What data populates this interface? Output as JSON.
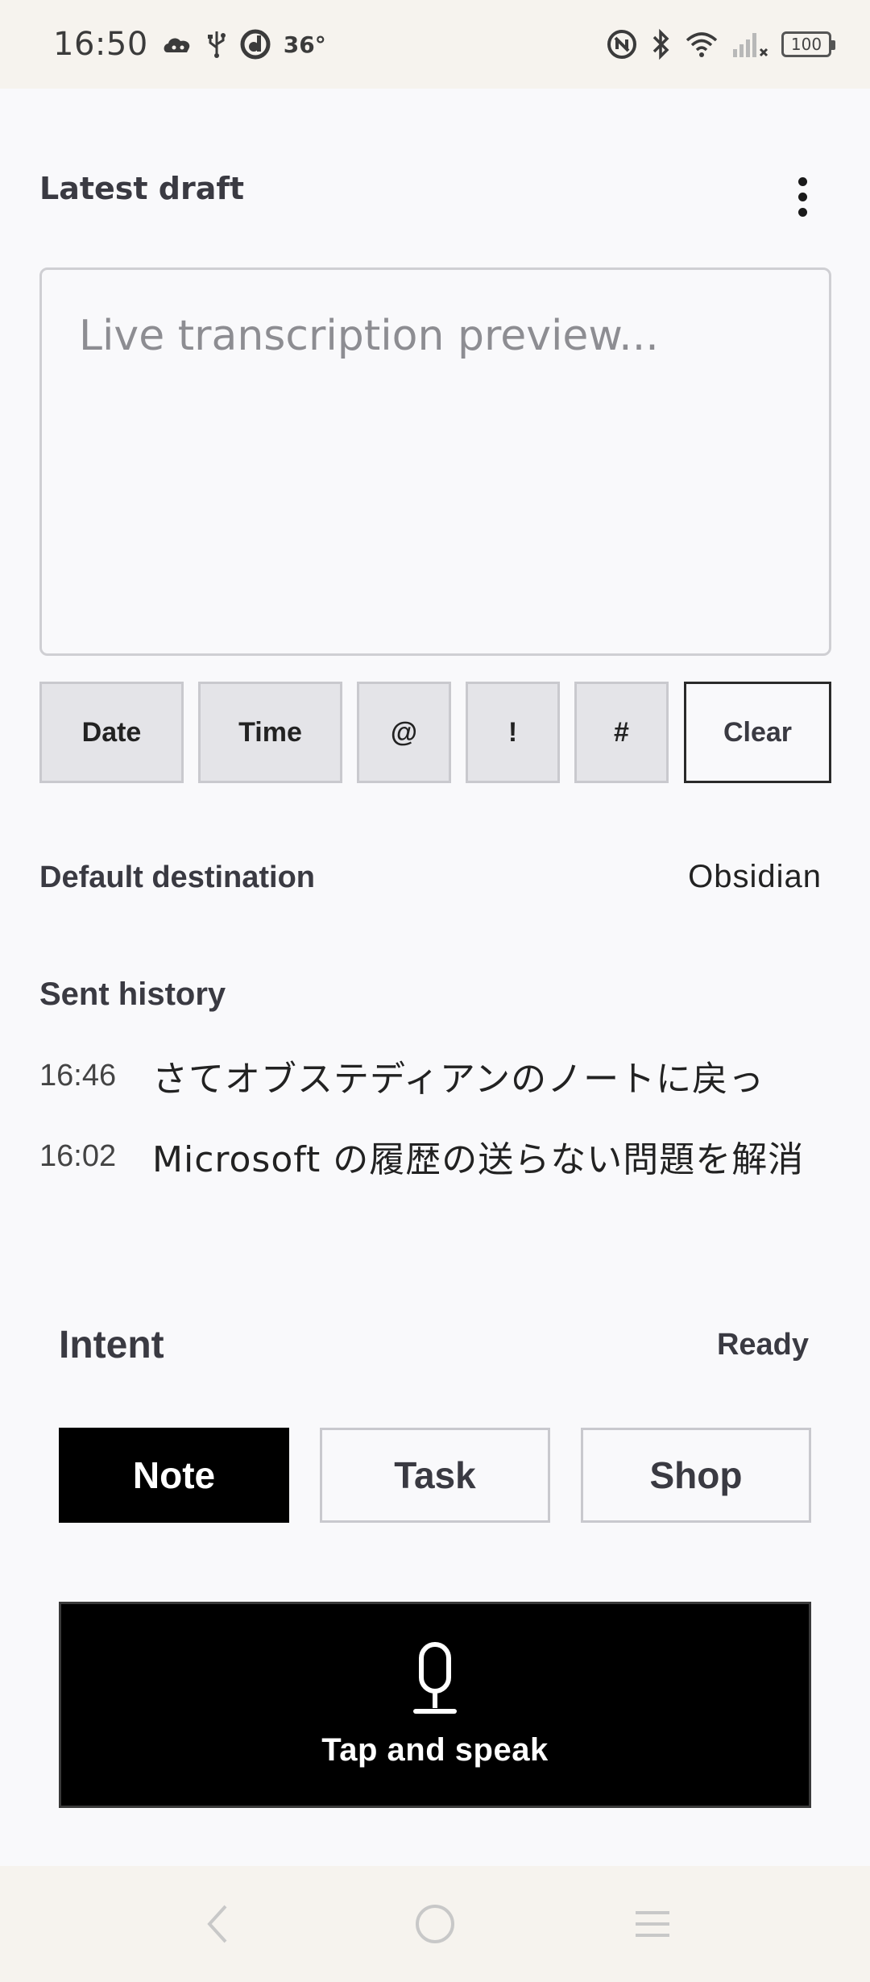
{
  "status_bar": {
    "time": "16:50",
    "temperature": "36°",
    "battery": "100",
    "icons": [
      "cloud-game-icon",
      "usb-icon",
      "d-app-icon",
      "nfc-icon",
      "bluetooth-icon",
      "wifi-icon",
      "signal-icon",
      "battery-icon"
    ]
  },
  "header": {
    "title": "Latest draft",
    "menu_icon": "more-vertical-icon"
  },
  "transcript": {
    "placeholder": "Live transcription preview..."
  },
  "quick_buttons": {
    "date": "Date",
    "time": "Time",
    "at": "@",
    "bang": "!",
    "hash": "#",
    "clear": "Clear"
  },
  "destination": {
    "label": "Default destination",
    "value": "Obsidian"
  },
  "history": {
    "title": "Sent history",
    "items": [
      {
        "time": "16:46",
        "text": "さてオブステディアンのノートに戻っ"
      },
      {
        "time": "16:02",
        "text": "Microsoft の履歴の送らない問題を解消"
      }
    ]
  },
  "intent": {
    "title": "Intent",
    "status": "Ready",
    "options": [
      "Note",
      "Task",
      "Shop"
    ],
    "selected": "Note"
  },
  "speak": {
    "label": "Tap and speak",
    "icon": "microphone-icon"
  },
  "nav": {
    "icons": [
      "back-icon",
      "home-icon",
      "recents-icon"
    ]
  },
  "colors": {
    "background": "#f9f9fb",
    "system_bar": "#f6f3ee",
    "accent": "#000000",
    "button_fill": "#e4e4e8"
  }
}
